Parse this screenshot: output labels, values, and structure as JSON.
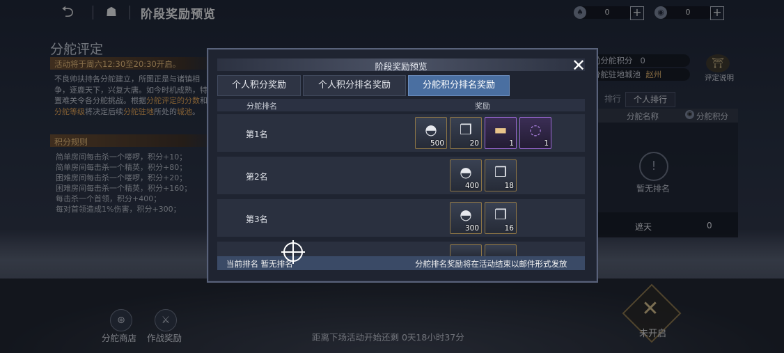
{
  "topbar": {
    "title": "阶段奖励预览",
    "currency1": {
      "value": "0",
      "icon": "spade-currency-icon"
    },
    "currency2": {
      "value": "0",
      "icon": "coin-currency-icon"
    }
  },
  "left_panel": {
    "title": "分舵评定",
    "notice": "活动将于周六12:30至20:30开启。",
    "desc_1": "不良帅扶持各分舵建立，所图正是与诸镇相争，逐鹿天下，兴复大唐。如今时机成熟，特置难关令各分舵挑战。根据",
    "desc_hl1": "分舵评定的分数",
    "desc_2": "和",
    "desc_hl2": "分舵等级",
    "desc_3": "将决定后续",
    "desc_hl3": "分舵驻地",
    "desc_4": "所处的",
    "desc_hl4": "城池",
    "desc_5": "。",
    "rules_title": "积分规则",
    "rules": [
      "简单房间每击杀一个喽啰，积分+10；",
      "简单房间每击杀一个精英，积分+80；",
      "困难房间每击杀一个喽啰，积分+20；",
      "困难房间每击杀一个精英，积分+160；",
      "每击杀一个首领，积分+400；",
      "每对首领造成1%伤害，积分+300；"
    ]
  },
  "right_panel": {
    "score_label": "前分舵积分",
    "score_value": "0",
    "city_label": "分舵驻地城池",
    "city_value": "赵州",
    "help_label": "评定说明",
    "tab_rank": "排行",
    "tab_personal": "个人排行",
    "col_name": "分舵名称",
    "col_score": "分舵积分",
    "empty_text": "暂无排名",
    "row_name": "遮天",
    "row_score": "0"
  },
  "bottom": {
    "shop_label": "分舵商店",
    "battle_label": "作战奖励",
    "timer": "距离下场活动开始还剩  0天18小时37分",
    "start_label": "未开启"
  },
  "modal": {
    "title": "阶段奖励预览",
    "tabs": [
      "个人积分奖励",
      "个人积分排名奖励",
      "分舵积分排名奖励"
    ],
    "active_tab": 2,
    "col_rank": "分舵排名",
    "col_reward": "奖励",
    "rows": [
      {
        "rank": "第1名",
        "items": [
          {
            "icon": "silver-ingot-icon",
            "glyph": "◓",
            "qty": "500",
            "rarity": "gold"
          },
          {
            "icon": "scroll-token-icon",
            "glyph": "❒",
            "qty": "20",
            "rarity": "gold"
          },
          {
            "icon": "title-plaque-icon",
            "glyph": "▬",
            "qty": "1",
            "rarity": "purple"
          },
          {
            "icon": "purple-aura-icon",
            "glyph": "◌",
            "qty": "1",
            "rarity": "purple"
          }
        ]
      },
      {
        "rank": "第2名",
        "items": [
          {
            "icon": "silver-ingot-icon",
            "glyph": "◓",
            "qty": "400",
            "rarity": "gold"
          },
          {
            "icon": "scroll-token-icon",
            "glyph": "❒",
            "qty": "18",
            "rarity": "gold"
          }
        ]
      },
      {
        "rank": "第3名",
        "items": [
          {
            "icon": "silver-ingot-icon",
            "glyph": "◓",
            "qty": "300",
            "rarity": "gold"
          },
          {
            "icon": "scroll-token-icon",
            "glyph": "❒",
            "qty": "16",
            "rarity": "gold"
          }
        ]
      }
    ],
    "footer_left": "当前排名  暂无排名",
    "footer_right": "分舵排名奖励将在活动结束以邮件形式发放"
  }
}
